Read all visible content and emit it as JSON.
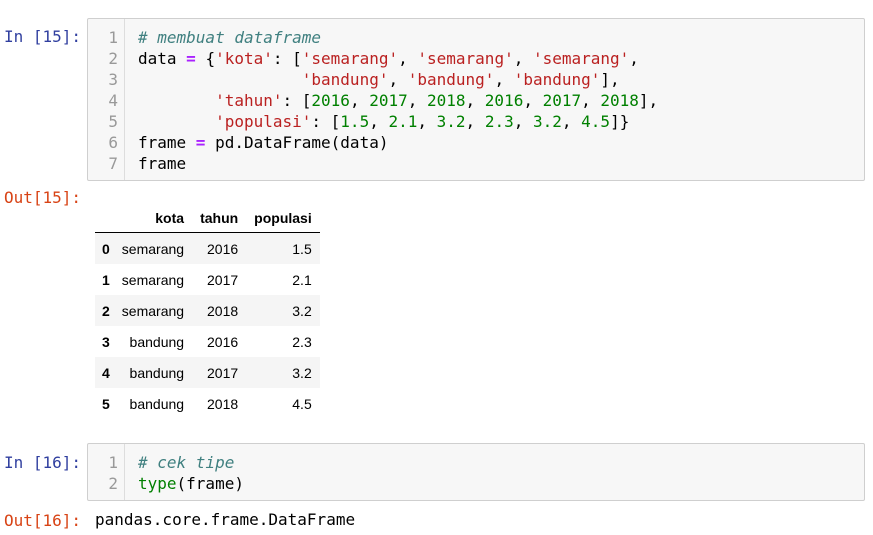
{
  "cells": [
    {
      "in_prompt": "In [15]:",
      "out_prompt": "Out[15]:",
      "line_numbers": [
        "1",
        "2",
        "3",
        "4",
        "5",
        "6",
        "7"
      ],
      "code_lines": [
        "# membuat dataframe",
        "data = {'kota': ['semarang', 'semarang', 'semarang',",
        "                 'bandung', 'bandung', 'bandung'],",
        "        'tahun': [2016, 2017, 2018, 2016, 2017, 2018],",
        "        'populasi': [1.5, 2.1, 3.2, 2.3, 3.2, 4.5]}",
        "frame = pd.DataFrame(data)",
        "frame"
      ],
      "output_table": {
        "columns": [
          "kota",
          "tahun",
          "populasi"
        ],
        "rows": [
          {
            "index": "0",
            "kota": "semarang",
            "tahun": "2016",
            "populasi": "1.5"
          },
          {
            "index": "1",
            "kota": "semarang",
            "tahun": "2017",
            "populasi": "2.1"
          },
          {
            "index": "2",
            "kota": "semarang",
            "tahun": "2018",
            "populasi": "3.2"
          },
          {
            "index": "3",
            "kota": "bandung",
            "tahun": "2016",
            "populasi": "2.3"
          },
          {
            "index": "4",
            "kota": "bandung",
            "tahun": "2017",
            "populasi": "3.2"
          },
          {
            "index": "5",
            "kota": "bandung",
            "tahun": "2018",
            "populasi": "4.5"
          }
        ]
      }
    },
    {
      "in_prompt": "In [16]:",
      "out_prompt": "Out[16]:",
      "line_numbers": [
        "1",
        "2"
      ],
      "code_lines": [
        "# cek tipe",
        "type(frame)"
      ],
      "output_text": "pandas.core.frame.DataFrame"
    }
  ]
}
